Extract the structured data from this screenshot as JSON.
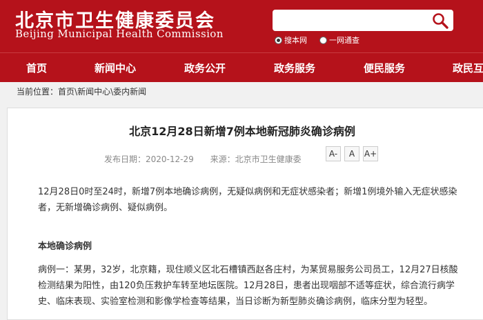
{
  "header": {
    "title_cn": "北京市卫生健康委员会",
    "title_en": "Beijing Municipal Health Commission",
    "search": {
      "placeholder": "",
      "options": [
        "搜本网",
        "一网通查"
      ],
      "selected": "搜本网"
    }
  },
  "nav": {
    "items": [
      "首页",
      "新闻中心",
      "政务公开",
      "政务服务",
      "便民服务",
      "政民互动"
    ]
  },
  "breadcrumb": {
    "prefix": "当前位置：",
    "items": [
      "首页",
      "新闻中心",
      "委内新闻"
    ],
    "separator": "\\"
  },
  "article": {
    "title": "北京12月28日新增7例本地新冠肺炎确诊病例",
    "publish_label": "发布日期：",
    "publish_date": "2020-12-29",
    "source_label": "来源：",
    "source": "北京市卫生健康委",
    "font_buttons": [
      "A-",
      "A",
      "A+"
    ],
    "paragraph1": "12月28日0时至24时，新增7例本地确诊病例，无疑似病例和无症状感染者；新增1例境外输入无症状感染者，无新增确诊病例、疑似病例。",
    "subheading": "本地确诊病例",
    "paragraph2": "病例一：某男，32岁，北京籍，现住顺义区北石槽镇西赵各庄村，为某贸易服务公司员工，12月27日核酸检测结果为阳性，由120负压救护车转至地坛医院。12月28日，患者出现咽部不适等症状，综合流行病学史、临床表现、实验室检测和影像学检查等结果，当日诊断为新型肺炎确诊病例，临床分型为轻型。"
  },
  "colors": {
    "brand_red": "#b5121b",
    "background": "#f1f1f1"
  }
}
